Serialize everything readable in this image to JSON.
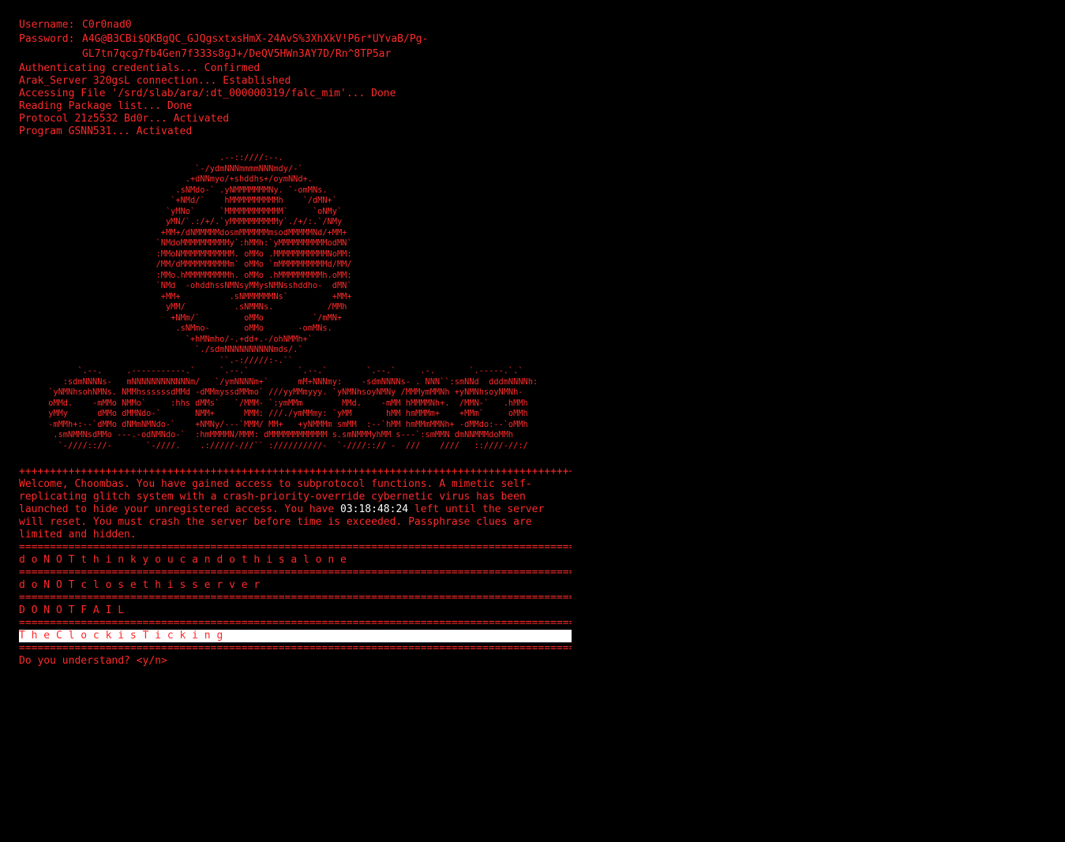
{
  "credentials": {
    "username_label": "Username:",
    "username_value": "C0r0nad0",
    "password_label": "Password:",
    "password_line1": "A4G@B3CBi$QKBgQC_GJQgsxtxsHmX-24AvS%3XhXkV!P6r*UYvaB/Pg-",
    "password_line2": "GL7tn7qcg7fb4Gen7f333s8gJ+/DeQV5HWn3AY7D/Rn^8TP5ar"
  },
  "status_lines": [
    "Authenticating credentials... Confirmed",
    "Arak_Server 320gsL connection... Established",
    "Accessing File '/srd/slab/ara/:dt_000000319/falc_mim'... Done",
    "Reading Package list... Done",
    "Protocol 21z5532 Bd0r... Activated",
    "Program GSNN531... Activated"
  ],
  "ascii_art": "                                         .--::////:--.\n                                    `-/ydmNNNmmmmNNNmdy/-`\n                                  .+dNNmyo/+shddhs+/oymNNd+.\n                                .sNMdo-` .yNMMMMMMMNy. `-omMNs.\n                               `+NMd/`    hMMMMMMMMMMh    `/dMN+`\n                              `yMNo`     `MMMMMMMMMMMM`     `oNMy`\n                              yMN/`.:/+/.`yMMMMMMMMMMy`./+/:.`/NMy\n                             +MM+/dNMMMMMdosmMMMMMMmsodMMMMMNd/+MM+\n                            `NMdoMMMMMMMMMMy`:hMMh:`yMMMMMMMMMModMN`\n                            :MMoNMMMMMMMMMMM. oMMo .MMMMMMMMMMMNoMM:\n                            /MM/dMMMMMMMMMMm` oMMo `mMMMMMMMMMMd/MM/\n                            :MMo.hMMMMMMMMMh. oMMo .hMMMMMMMMMh.oMM:\n                            `NMd  -ohddhssNMNsyMMysNMNsshddho-  dMN`\n                             +MM+          .sNMMMMMMNs`         +MM+\n                              yMM/          .sNMMNs.           /MMh\n                               +NMm/`         oMMo          `/mMN+\n                                .sNMmo-       oMMo       -omMNs.\n                                  `+hMNmho/-.+dd+.-/ohNMMh+`\n                                    `./sdmNNNNNNNNNNmds/.`\n                                         ``.-://///:-.``\n            `.--.     .-----------.`     `.--.`          `.--.`        `.--.`     .-.       `.-----.`.`\n         :sdmNNNNs-   mNNNNNNNNNNNNm/   `/ymNNNNm+`      mM+NNNmy:    -sdmNNNNs- . NNN``:smNNd  dddmNNNNh:\n      `yNMNhsohNMNs. NMMhssssssdMMd -dMMmyssdMMmo` ///yyMMmyyy. `yNMNhsoyNMNy /MMMymMMNh +yNMNhsoyNMNh-\n      oMMd.    -mMMo NMMo`     :hhs dMMs`   `/MMM- `:ymMMm        MMd.    -mMM hMMMMNh+.  /MMN-`   .hMMh\n      yMMy      dMMo dMMNdo-`       NMM+      MMM: ///./ymMMmy: `yMM       hMM hmMMMm+    +MMm`     oMMh\n      -mMMh+:--`dMMo dNMmNMNdo-`    +NMNy/---`MMM/ MM+   +yNMMMm smMM  :--`hMM hmMMmMMNh+ -dMMdo:--`oMMh\n       .smNMMNsdMMo ---.-odNMNdo-`  :hmMMMMN/MMM: dMMMMMMMMMMMM s.smNMMMyhMM s---`:smMMN dmNNMMMdoMMh\n        `-////:://-       `-////.    .://///-///`` ://////////-  `-////::// -  ///    ////   ::////-//:/",
  "separator_plus": "++++++++++++++++++++++++++++++++++++++++++++++++++++++++++++++++++++++++++++++++++++++++++++++++++++++",
  "separator_eq": "====================================================================================================",
  "welcome": {
    "before_timer": "Welcome, Choombas. You have gained access to subprotocol functions. A mimetic self-replicating glitch system with a crash-priority-override cybernetic virus has been launched to hide your unregistered access. You have",
    "timer": "03:18:48:24",
    "after_timer": "left until the server will reset. You must crash the server before time is exceeded. Passphrase clues are limited and hidden."
  },
  "messages": [
    "d o N O T t h i n k y o u c a n d o t h i s a l o n e",
    "d o N O T c l o s e t h i s s e r v e r",
    "D O N O T F A I L",
    "T h e C l o c k i s T i c k i n g"
  ],
  "prompt": "Do you understand? <y/n>",
  "colors": {
    "background": "#000000",
    "text": "#ff2a2a",
    "timer": "#ffffff",
    "highlight_bg": "#ffffff"
  }
}
